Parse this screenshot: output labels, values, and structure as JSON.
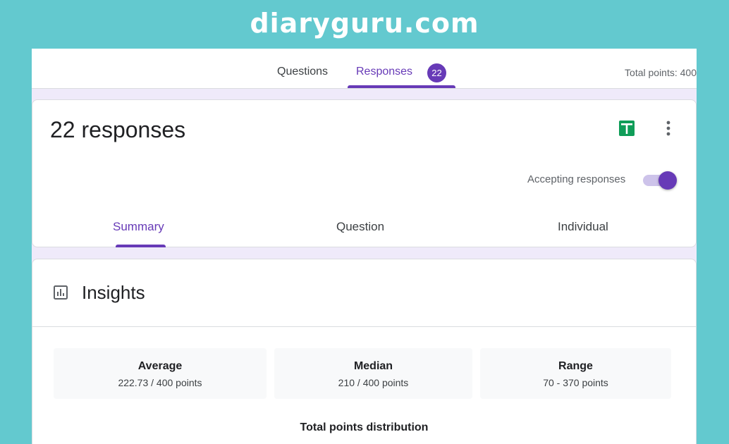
{
  "brand": {
    "name": "diaryguru.com"
  },
  "header": {
    "tabs": [
      {
        "label": "Questions",
        "active": false
      },
      {
        "label": "Responses",
        "active": true,
        "badge": "22"
      }
    ],
    "total_points": "Total points: 400"
  },
  "responses_card": {
    "title": "22 responses",
    "sheets_icon": "google-sheets-icon",
    "more_icon": "more-vert-icon",
    "accepting_label": "Accepting responses",
    "accepting_enabled": true,
    "subtabs": [
      {
        "label": "Summary",
        "active": true
      },
      {
        "label": "Question",
        "active": false
      },
      {
        "label": "Individual",
        "active": false
      }
    ]
  },
  "insights": {
    "icon": "insights-chart-icon",
    "title": "Insights",
    "stats": [
      {
        "label": "Average",
        "value": "222.73 / 400 points"
      },
      {
        "label": "Median",
        "value": "210 / 400 points"
      },
      {
        "label": "Range",
        "value": "70 - 370 points"
      }
    ],
    "distribution_title": "Total points distribution"
  },
  "colors": {
    "page_background": "#63c9cf",
    "accent": "#673ab7",
    "sheets_green": "#0f9d58",
    "muted_text": "#5f6368"
  }
}
